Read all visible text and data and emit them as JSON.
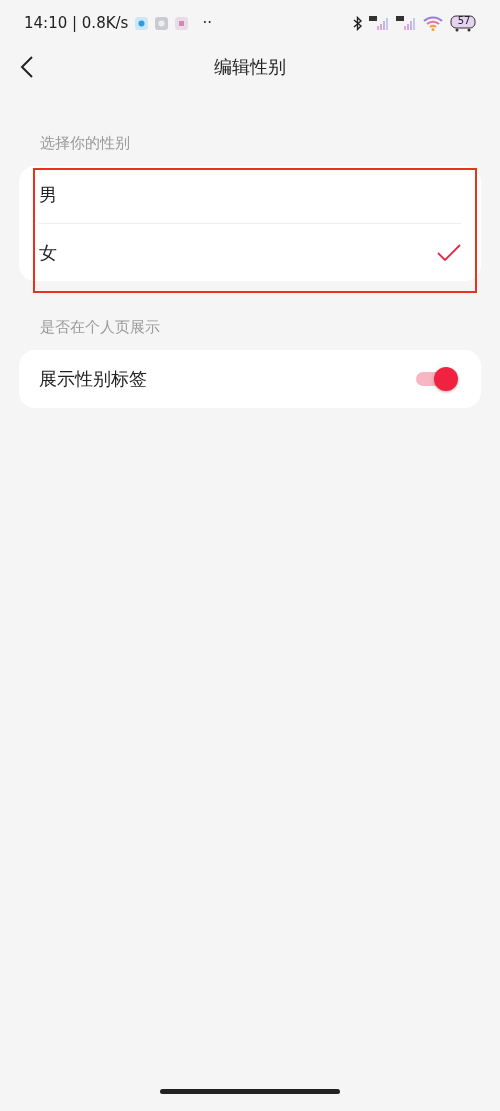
{
  "status_bar": {
    "time": "14:10 | 0.8K/s",
    "more": "··",
    "battery": "57"
  },
  "nav": {
    "title": "编辑性别"
  },
  "gender_section": {
    "label": "选择你的性别",
    "highlighted": true,
    "options": [
      {
        "label": "男",
        "selected": false
      },
      {
        "label": "女",
        "selected": true
      }
    ]
  },
  "display_section": {
    "label": "是否在个人页展示",
    "toggle": {
      "label": "展示性别标签",
      "on": true
    }
  }
}
